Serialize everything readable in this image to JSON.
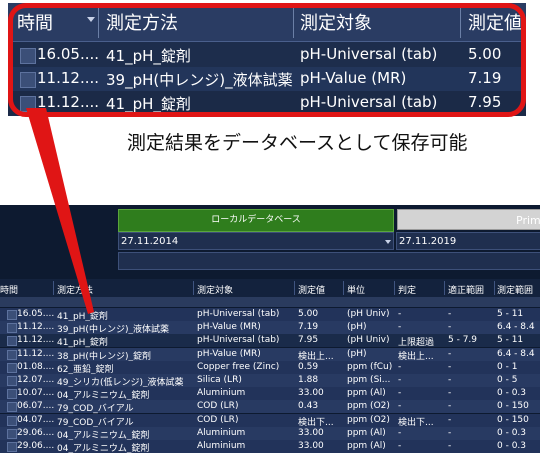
{
  "zoom": {
    "headers": [
      "時間",
      "測定方法",
      "測定対象",
      "測定値"
    ],
    "rows": [
      {
        "time": "16.05....",
        "method": "41_pH_錠剤",
        "target": "pH-Universal (tab)",
        "value": "5.00"
      },
      {
        "time": "11.12....",
        "method": "39_pH(中レンジ)_液体試薬",
        "target": "pH-Value (MR)",
        "value": "7.19"
      },
      {
        "time": "11.12....",
        "method": "41_pH_錠剤",
        "target": "pH-Universal (tab)",
        "value": "7.95"
      }
    ]
  },
  "caption": "測定結果をデータベースとして保存可能",
  "app": {
    "local_db_button": "ローカルデータベース",
    "prime_button": "Prime",
    "date_from": "27.11.2014",
    "date_to": "27.11.2019",
    "filter_value": "",
    "headers": [
      "時間",
      "測定方法",
      "測定対象",
      "測定値",
      "単位",
      "判定",
      "適正範囲",
      "測定範囲"
    ],
    "rows": [
      {
        "time": "16.05....",
        "method": "41_pH_錠剤",
        "target": "pH-Universal (tab)",
        "value": "5.00",
        "unit": "(pH Univ)",
        "judge": "-",
        "proper": "-",
        "range": "5 - 11"
      },
      {
        "time": "11.12....",
        "method": "39_pH(中レンジ)_液体試薬",
        "target": "pH-Value (MR)",
        "value": "7.19",
        "unit": "(pH)",
        "judge": "-",
        "proper": "-",
        "range": "6.4 - 8.4"
      },
      {
        "time": "11.12....",
        "method": "41_pH_錠剤",
        "target": "pH-Universal (tab)",
        "value": "7.95",
        "unit": "(pH Univ)",
        "judge": "上限超過",
        "proper": "5 - 7.9",
        "range": "5 - 11"
      },
      {
        "time": "11.12....",
        "method": "38_pH(中レンジ)_錠剤",
        "target": "pH-Value (MR)",
        "value": "検出上...",
        "unit": "(pH)",
        "judge": "検出上...",
        "proper": "-",
        "range": "6.4 - 8.4"
      },
      {
        "time": "01.08....",
        "method": "62_亜鉛_錠剤",
        "target": "Copper free (Zinc)",
        "value": "0.59",
        "unit": "ppm (fCu)",
        "judge": "-",
        "proper": "-",
        "range": "0 - 1"
      },
      {
        "time": "12.07....",
        "method": "49_シリカ(低レンジ)_液体試薬",
        "target": "Silica (LR)",
        "value": "1.88",
        "unit": "ppm (Si...",
        "judge": "-",
        "proper": "-",
        "range": "0 - 5"
      },
      {
        "time": "10.07....",
        "method": "04_アルミニウム_錠剤",
        "target": "Aluminium",
        "value": "33.00",
        "unit": "ppm (Al)",
        "judge": "-",
        "proper": "-",
        "range": "0 - 0.3"
      },
      {
        "time": "06.07....",
        "method": "79_COD_バイアル",
        "target": "COD (LR)",
        "value": "0.43",
        "unit": "ppm (O2)",
        "judge": "-",
        "proper": "-",
        "range": "0 - 150"
      },
      {
        "time": "04.07....",
        "method": "79_COD_バイアル",
        "target": "COD (LR)",
        "value": "検出下...",
        "unit": "ppm (O2)",
        "judge": "検出下...",
        "proper": "-",
        "range": "0 - 150"
      },
      {
        "time": "29.06....",
        "method": "04_アルミニウム_錠剤",
        "target": "Aluminium",
        "value": "33.00",
        "unit": "ppm (Al)",
        "judge": "-",
        "proper": "-",
        "range": "0 - 0.3"
      },
      {
        "time": "29.06....",
        "method": "04_アルミニウム_錠剤",
        "target": "Aluminium",
        "value": "33.00",
        "unit": "ppm (Al)",
        "judge": "-",
        "proper": "-",
        "range": "0 - 0.3"
      }
    ]
  },
  "colors": {
    "callout_border": "#e01515",
    "local_button": "#2f7d1d",
    "app_background": "#0d1a30"
  }
}
